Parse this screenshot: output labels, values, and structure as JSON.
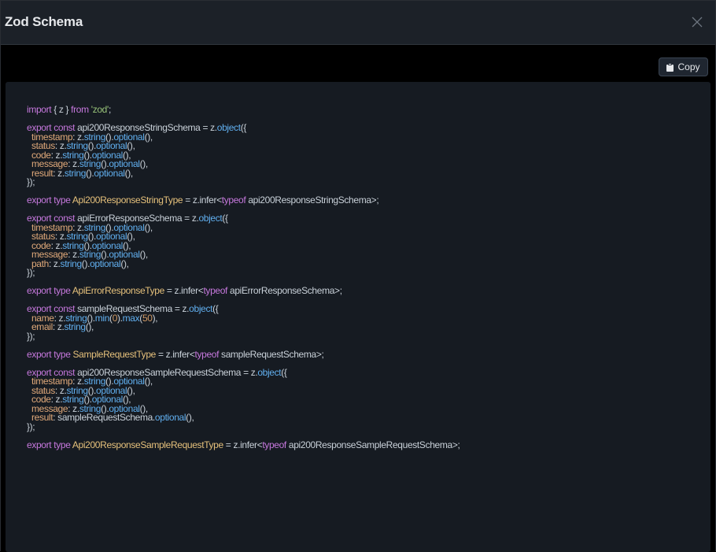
{
  "modal": {
    "title": "Zod Schema",
    "copy_label": "Copy"
  },
  "colors": {
    "keyword": "#c678dd",
    "string": "#98c379",
    "function": "#61afef",
    "type": "#e5c07b",
    "number": "#d19a66",
    "property": "#e0a97a",
    "plain": "#c9d1d9"
  },
  "code_lines": [
    [
      [
        "kw",
        "import"
      ],
      [
        "plain",
        " { z } "
      ],
      [
        "kw",
        "from"
      ],
      [
        "plain",
        " "
      ],
      [
        "str",
        "'zod'"
      ],
      [
        "plain",
        ";"
      ]
    ],
    [],
    [
      [
        "kw",
        "export const"
      ],
      [
        "plain",
        " api200ResponseStringSchema = z."
      ],
      [
        "fn",
        "object"
      ],
      [
        "plain",
        "({"
      ]
    ],
    [
      [
        "prop",
        "  timestamp"
      ],
      [
        "plain",
        ": z."
      ],
      [
        "fn",
        "string"
      ],
      [
        "plain",
        "()."
      ],
      [
        "fn",
        "optional"
      ],
      [
        "plain",
        "(),"
      ]
    ],
    [
      [
        "prop",
        "  status"
      ],
      [
        "plain",
        ": z."
      ],
      [
        "fn",
        "string"
      ],
      [
        "plain",
        "()."
      ],
      [
        "fn",
        "optional"
      ],
      [
        "plain",
        "(),"
      ]
    ],
    [
      [
        "prop",
        "  code"
      ],
      [
        "plain",
        ": z."
      ],
      [
        "fn",
        "string"
      ],
      [
        "plain",
        "()."
      ],
      [
        "fn",
        "optional"
      ],
      [
        "plain",
        "(),"
      ]
    ],
    [
      [
        "prop",
        "  message"
      ],
      [
        "plain",
        ": z."
      ],
      [
        "fn",
        "string"
      ],
      [
        "plain",
        "()."
      ],
      [
        "fn",
        "optional"
      ],
      [
        "plain",
        "(),"
      ]
    ],
    [
      [
        "prop",
        "  result"
      ],
      [
        "plain",
        ": z."
      ],
      [
        "fn",
        "string"
      ],
      [
        "plain",
        "()."
      ],
      [
        "fn",
        "optional"
      ],
      [
        "plain",
        "(),"
      ]
    ],
    [
      [
        "plain",
        "});"
      ]
    ],
    [],
    [
      [
        "kw",
        "export type"
      ],
      [
        "plain",
        " "
      ],
      [
        "ty",
        "Api200ResponseStringType"
      ],
      [
        "plain",
        " = z.infer<"
      ],
      [
        "kw",
        "typeof"
      ],
      [
        "plain",
        " api200ResponseStringSchema>;"
      ]
    ],
    [],
    [
      [
        "kw",
        "export const"
      ],
      [
        "plain",
        " apiErrorResponseSchema = z."
      ],
      [
        "fn",
        "object"
      ],
      [
        "plain",
        "({"
      ]
    ],
    [
      [
        "prop",
        "  timestamp"
      ],
      [
        "plain",
        ": z."
      ],
      [
        "fn",
        "string"
      ],
      [
        "plain",
        "()."
      ],
      [
        "fn",
        "optional"
      ],
      [
        "plain",
        "(),"
      ]
    ],
    [
      [
        "prop",
        "  status"
      ],
      [
        "plain",
        ": z."
      ],
      [
        "fn",
        "string"
      ],
      [
        "plain",
        "()."
      ],
      [
        "fn",
        "optional"
      ],
      [
        "plain",
        "(),"
      ]
    ],
    [
      [
        "prop",
        "  code"
      ],
      [
        "plain",
        ": z."
      ],
      [
        "fn",
        "string"
      ],
      [
        "plain",
        "()."
      ],
      [
        "fn",
        "optional"
      ],
      [
        "plain",
        "(),"
      ]
    ],
    [
      [
        "prop",
        "  message"
      ],
      [
        "plain",
        ": z."
      ],
      [
        "fn",
        "string"
      ],
      [
        "plain",
        "()."
      ],
      [
        "fn",
        "optional"
      ],
      [
        "plain",
        "(),"
      ]
    ],
    [
      [
        "prop",
        "  path"
      ],
      [
        "plain",
        ": z."
      ],
      [
        "fn",
        "string"
      ],
      [
        "plain",
        "()."
      ],
      [
        "fn",
        "optional"
      ],
      [
        "plain",
        "(),"
      ]
    ],
    [
      [
        "plain",
        "});"
      ]
    ],
    [],
    [
      [
        "kw",
        "export type"
      ],
      [
        "plain",
        " "
      ],
      [
        "ty",
        "ApiErrorResponseType"
      ],
      [
        "plain",
        " = z.infer<"
      ],
      [
        "kw",
        "typeof"
      ],
      [
        "plain",
        " apiErrorResponseSchema>;"
      ]
    ],
    [],
    [
      [
        "kw",
        "export const"
      ],
      [
        "plain",
        " sampleRequestSchema = z."
      ],
      [
        "fn",
        "object"
      ],
      [
        "plain",
        "({"
      ]
    ],
    [
      [
        "prop",
        "  name"
      ],
      [
        "plain",
        ": z."
      ],
      [
        "fn",
        "string"
      ],
      [
        "plain",
        "()."
      ],
      [
        "fn",
        "min"
      ],
      [
        "plain",
        "("
      ],
      [
        "num",
        "0"
      ],
      [
        "plain",
        ")."
      ],
      [
        "fn",
        "max"
      ],
      [
        "plain",
        "("
      ],
      [
        "num",
        "50"
      ],
      [
        "plain",
        "),"
      ]
    ],
    [
      [
        "prop",
        "  email"
      ],
      [
        "plain",
        ": z."
      ],
      [
        "fn",
        "string"
      ],
      [
        "plain",
        "(),"
      ]
    ],
    [
      [
        "plain",
        "});"
      ]
    ],
    [],
    [
      [
        "kw",
        "export type"
      ],
      [
        "plain",
        " "
      ],
      [
        "ty",
        "SampleRequestType"
      ],
      [
        "plain",
        " = z.infer<"
      ],
      [
        "kw",
        "typeof"
      ],
      [
        "plain",
        " sampleRequestSchema>;"
      ]
    ],
    [],
    [
      [
        "kw",
        "export const"
      ],
      [
        "plain",
        " api200ResponseSampleRequestSchema = z."
      ],
      [
        "fn",
        "object"
      ],
      [
        "plain",
        "({"
      ]
    ],
    [
      [
        "prop",
        "  timestamp"
      ],
      [
        "plain",
        ": z."
      ],
      [
        "fn",
        "string"
      ],
      [
        "plain",
        "()."
      ],
      [
        "fn",
        "optional"
      ],
      [
        "plain",
        "(),"
      ]
    ],
    [
      [
        "prop",
        "  status"
      ],
      [
        "plain",
        ": z."
      ],
      [
        "fn",
        "string"
      ],
      [
        "plain",
        "()."
      ],
      [
        "fn",
        "optional"
      ],
      [
        "plain",
        "(),"
      ]
    ],
    [
      [
        "prop",
        "  code"
      ],
      [
        "plain",
        ": z."
      ],
      [
        "fn",
        "string"
      ],
      [
        "plain",
        "()."
      ],
      [
        "fn",
        "optional"
      ],
      [
        "plain",
        "(),"
      ]
    ],
    [
      [
        "prop",
        "  message"
      ],
      [
        "plain",
        ": z."
      ],
      [
        "fn",
        "string"
      ],
      [
        "plain",
        "()."
      ],
      [
        "fn",
        "optional"
      ],
      [
        "plain",
        "(),"
      ]
    ],
    [
      [
        "prop",
        "  result"
      ],
      [
        "plain",
        ": sampleRequestSchema."
      ],
      [
        "fn",
        "optional"
      ],
      [
        "plain",
        "(),"
      ]
    ],
    [
      [
        "plain",
        "});"
      ]
    ],
    [],
    [
      [
        "kw",
        "export type"
      ],
      [
        "plain",
        " "
      ],
      [
        "ty",
        "Api200ResponseSampleRequestType"
      ],
      [
        "plain",
        " = z.infer<"
      ],
      [
        "kw",
        "typeof"
      ],
      [
        "plain",
        " api200ResponseSampleRequestSchema>;"
      ]
    ]
  ]
}
